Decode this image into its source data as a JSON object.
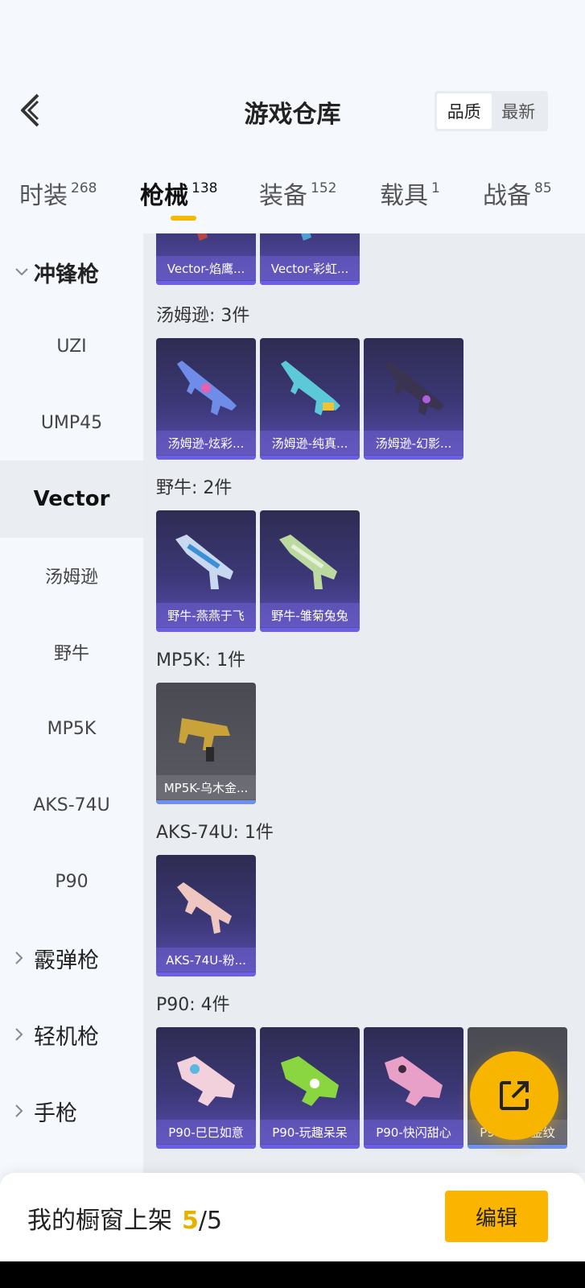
{
  "header": {
    "title": "游戏仓库",
    "sort": [
      "品质",
      "最新"
    ],
    "active_sort": 0
  },
  "tabs": [
    {
      "label": "时装",
      "count": "268"
    },
    {
      "label": "枪械",
      "count": "138"
    },
    {
      "label": "装备",
      "count": "152"
    },
    {
      "label": "载具",
      "count": "1"
    },
    {
      "label": "战备",
      "count": "85"
    }
  ],
  "sidebar": {
    "group_smg": "冲锋枪",
    "items": [
      "UZI",
      "UMP45",
      "Vector",
      "汤姆逊",
      "野牛",
      "MP5K",
      "AKS-74U",
      "P90"
    ],
    "active_item": "Vector",
    "group_shotgun": "霰弹枪",
    "group_lmg": "轻机枪",
    "group_pistol": "手枪"
  },
  "content": {
    "vector_cards": [
      "Vector-焰鹰...",
      "Vector-彩虹..."
    ],
    "sections": [
      {
        "title": "汤姆逊: 3件",
        "items": [
          "汤姆逊-炫彩...",
          "汤姆逊-纯真...",
          "汤姆逊-幻影..."
        ]
      },
      {
        "title": "野牛: 2件",
        "items": [
          "野牛-燕燕于飞",
          "野牛-雏菊兔兔"
        ]
      },
      {
        "title": "MP5K: 1件",
        "items": [
          "MP5K-乌木金..."
        ]
      },
      {
        "title": "AKS-74U: 1件",
        "items": [
          "AKS-74U-粉..."
        ]
      },
      {
        "title": "P90: 4件",
        "items": [
          "P90-巳巳如意",
          "P90-玩趣呆呆",
          "P90-快闪甜心",
          "P90-乌木金纹"
        ]
      }
    ]
  },
  "bottom": {
    "label": "我的橱窗上架",
    "current": "5",
    "separator": "/",
    "total": "5",
    "edit_label": "编辑"
  },
  "colors": {
    "accent": "#f7b500",
    "card_purple": "#3c3878",
    "card_gray": "#5b5c63"
  }
}
